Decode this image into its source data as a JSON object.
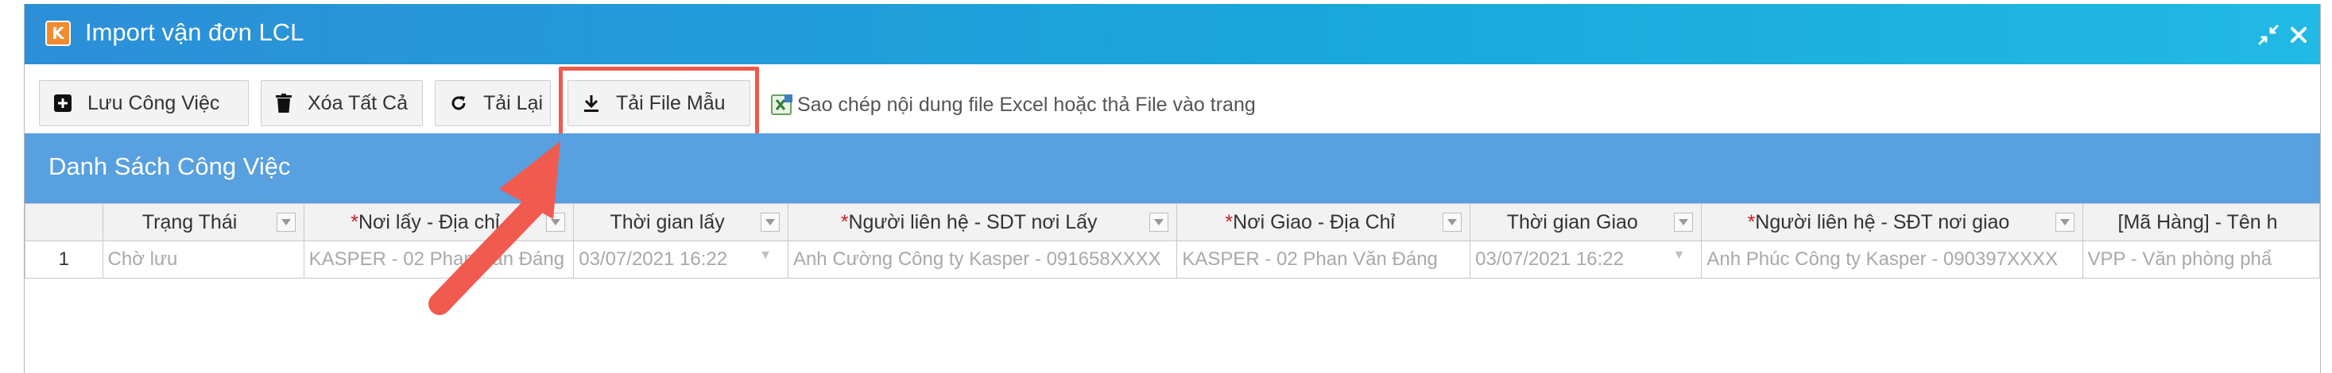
{
  "window": {
    "title": "Import vận đơn LCL",
    "logo_letter": "K",
    "accent_color": "#1aa6da",
    "icons": [
      "compress-icon",
      "close-icon"
    ]
  },
  "toolbar": {
    "save_label": "Lưu Công Việc",
    "clear_all_label": "Xóa Tất Cả",
    "reload_label": "Tải Lại",
    "download_template_label": "Tải File Mẫu",
    "paste_hint": "Sao chép nội dung file Excel hoặc thả File vào trang"
  },
  "section": {
    "title": "Danh Sách Công Việc"
  },
  "grid": {
    "columns": [
      {
        "label": "Trạng Thái",
        "required": false
      },
      {
        "label": "Nơi lấy - Địa chỉ",
        "required": true
      },
      {
        "label": "Thời gian lấy",
        "required": false
      },
      {
        "label": "Người liên hệ - SDT nơi Lấy",
        "required": true
      },
      {
        "label": "Nơi Giao - Địa Chỉ",
        "required": true
      },
      {
        "label": "Thời gian Giao",
        "required": false
      },
      {
        "label": "Người liên hệ - SĐT nơi giao",
        "required": true
      },
      {
        "label": "[Mã Hàng] - Tên h",
        "required": false
      }
    ],
    "required_marker": "*",
    "rows": [
      {
        "num": "1",
        "cells": [
          "Chờ lưu",
          "KASPER - 02 Phan Văn Đáng",
          "03/07/2021 16:22",
          "Anh Cường Công ty Kasper - 091658XXXX",
          "KASPER - 02 Phan Văn Đáng",
          "03/07/2021 16:22",
          "Anh Phúc Công ty Kasper - 090397XXXX",
          "VPP - Văn phòng phẩ"
        ]
      }
    ]
  },
  "annotation": {
    "highlight_color": "#ef5a4e",
    "points_to": "download_template_button"
  }
}
